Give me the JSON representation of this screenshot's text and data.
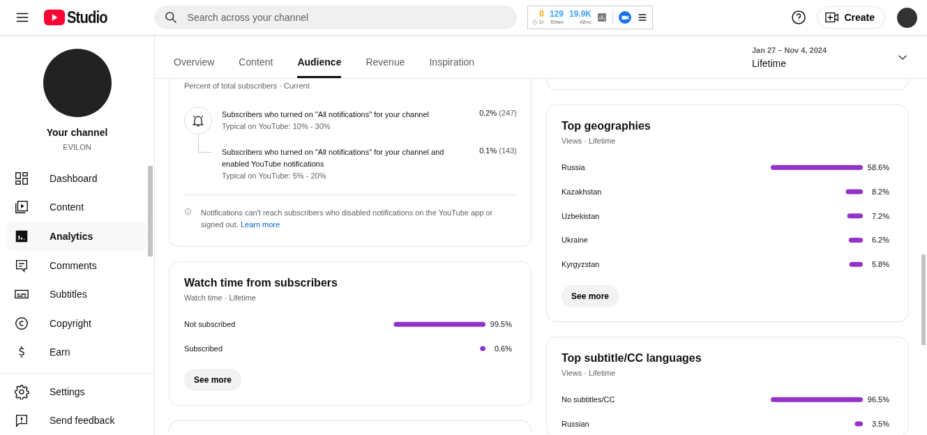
{
  "topbar": {
    "logo_text": "Studio",
    "search": {
      "placeholder": "Search across your channel"
    },
    "stats": [
      {
        "value": "0",
        "label": "1г",
        "color": "#f9ab00"
      },
      {
        "value": "129",
        "label": "60мн",
        "color": "#3ea6ff"
      },
      {
        "value": "19.9K",
        "label": "48чс",
        "color": "#3ea6ff"
      }
    ],
    "create_button": "Create"
  },
  "sidebar": {
    "channel_title": "Your channel",
    "channel_name": "EVILON",
    "items": [
      {
        "label": "Dashboard",
        "selected": false
      },
      {
        "label": "Content",
        "selected": false
      },
      {
        "label": "Analytics",
        "selected": true
      },
      {
        "label": "Comments",
        "selected": false
      },
      {
        "label": "Subtitles",
        "selected": false
      },
      {
        "label": "Copyright",
        "selected": false
      },
      {
        "label": "Earn",
        "selected": false
      }
    ],
    "footer_items": [
      {
        "label": "Settings"
      },
      {
        "label": "Send feedback"
      }
    ]
  },
  "tabs": [
    {
      "label": "Overview",
      "selected": false
    },
    {
      "label": "Content",
      "selected": false
    },
    {
      "label": "Audience",
      "selected": true
    },
    {
      "label": "Revenue",
      "selected": false
    },
    {
      "label": "Inspiration",
      "selected": false
    }
  ],
  "date_range": {
    "range": "Jan 27 – Nov 4, 2024",
    "period": "Lifetime"
  },
  "notifications_card": {
    "subtitle": "Percent of total subscribers · Current",
    "rows": [
      {
        "text": "Subscribers who turned on \"All notifications\" for your channel",
        "typical": "Typical on YouTube: 10% - 30%",
        "percent": "0.2%",
        "count": "(247)"
      },
      {
        "text": "Subscribers who turned on \"All notifications\" for your channel and enabled YouTube notifications",
        "typical": "Typical on YouTube: 5% - 20%",
        "percent": "0.1%",
        "count": "(143)"
      }
    ],
    "note": "Notifications can't reach subscribers who disabled notifications on the YouTube app or signed out.",
    "link": "Learn more"
  },
  "watch_time_card": {
    "title": "Watch time from subscribers",
    "subtitle": "Watch time · Lifetime",
    "chart_data": {
      "type": "bar",
      "orientation": "horizontal",
      "categories": [
        "Not subscribed",
        "Subscribed"
      ],
      "values": [
        99.5,
        0.6
      ],
      "value_labels": [
        "99.5%",
        "0.6%"
      ]
    },
    "button": "See more"
  },
  "geographies_card": {
    "title": "Top geographies",
    "subtitle": "Views · Lifetime",
    "chart_data": {
      "type": "bar",
      "orientation": "horizontal",
      "categories": [
        "Russia",
        "Kazakhstan",
        "Uzbekistan",
        "Ukraine",
        "Kyrgyzstan"
      ],
      "values": [
        58.6,
        8.2,
        7.2,
        6.2,
        5.8
      ],
      "value_labels": [
        "58.6%",
        "8.2%",
        "7.2%",
        "6.2%",
        "5.8%"
      ]
    },
    "button": "See more"
  },
  "subtitles_card": {
    "title": "Top subtitle/CC languages",
    "subtitle": "Views · Lifetime",
    "chart_data": {
      "type": "bar",
      "orientation": "horizontal",
      "categories": [
        "No subtitles/CC",
        "Russian"
      ],
      "values": [
        96.5,
        3.5
      ],
      "value_labels": [
        "96.5%",
        "3.5%"
      ]
    }
  }
}
